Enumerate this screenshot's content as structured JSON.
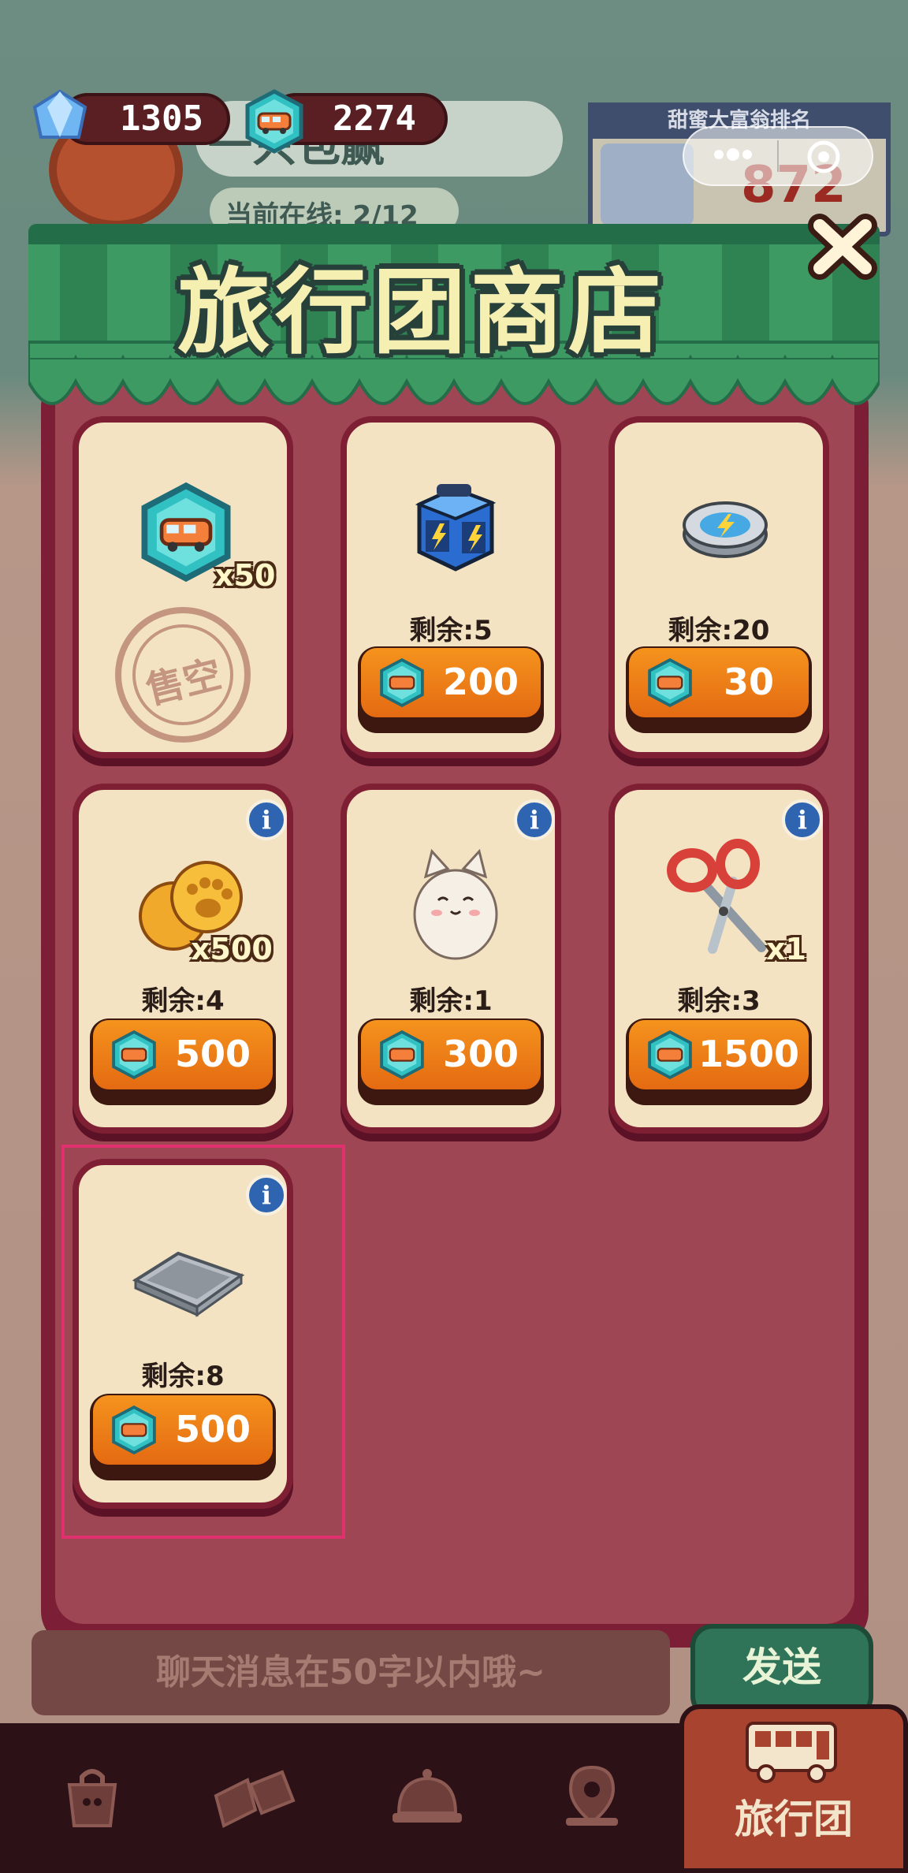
{
  "currency": {
    "gems": "1305",
    "tokens": "2274"
  },
  "background": {
    "room_title": "一只包赢",
    "online_label": "当前在线: 2/12",
    "rank_title": "甜蜜大富翁排名",
    "rank_value": "872"
  },
  "shop": {
    "title": "旅行团商店",
    "items": [
      {
        "name": "tour-token-pack",
        "quantity": "x50",
        "remaining": "",
        "price": "",
        "sold_out_label": "售空",
        "icon": "tour-token-icon",
        "has_info": true
      },
      {
        "name": "energy-box",
        "quantity": "",
        "remaining": "剩余:5",
        "price": "200",
        "icon": "energy-box-icon",
        "has_info": true
      },
      {
        "name": "energy-disc",
        "quantity": "",
        "remaining": "剩余:20",
        "price": "30",
        "icon": "energy-disc-icon",
        "has_info": true
      },
      {
        "name": "paw-cookies",
        "quantity": "x500",
        "remaining": "剩余:4",
        "price": "500",
        "icon": "paw-cookie-icon",
        "has_info": true
      },
      {
        "name": "lucky-cat",
        "quantity": "",
        "remaining": "剩余:1",
        "price": "300",
        "icon": "lucky-cat-icon",
        "has_info": true
      },
      {
        "name": "scissors",
        "quantity": "x1",
        "remaining": "剩余:3",
        "price": "1500",
        "icon": "scissors-icon",
        "has_info": true
      },
      {
        "name": "baking-tray",
        "quantity": "",
        "remaining": "剩余:8",
        "price": "500",
        "icon": "baking-tray-icon",
        "has_info": true
      }
    ]
  },
  "chat": {
    "placeholder": "聊天消息在50字以内哦~",
    "send_label": "发送"
  },
  "nav": {
    "items": [
      {
        "icon": "shop-bag-icon"
      },
      {
        "icon": "ticket-icon"
      },
      {
        "icon": "bell-icon"
      },
      {
        "icon": "map-pin-icon"
      },
      {
        "icon": "bus-icon",
        "label": "旅行团",
        "active": true
      }
    ]
  },
  "colors": {
    "panel": "#9e4654",
    "panel_border": "#7c1f36",
    "awning": "#3e9a63",
    "card": "#f3e3c2",
    "buy_button": "#ee7a16",
    "highlight": "#e0306e"
  }
}
